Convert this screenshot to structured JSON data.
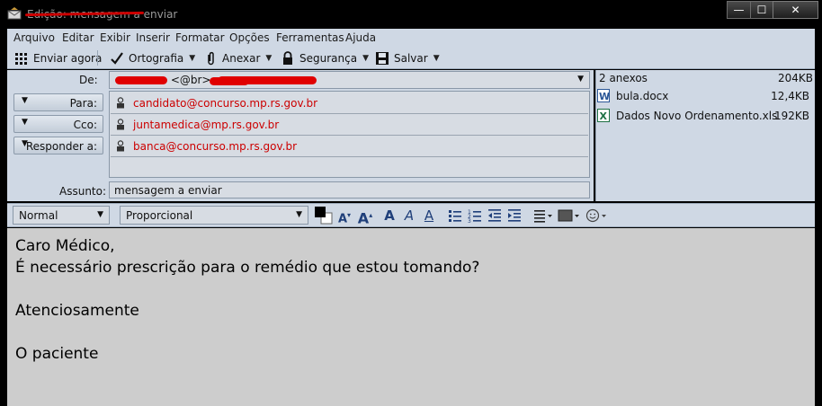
{
  "window": {
    "title": "Edição: mensagem a enviar",
    "buttons": {
      "minimize": "—",
      "maximize": "☐",
      "close": "✕"
    }
  },
  "menu": [
    "Arquivo",
    "Editar",
    "Exibir",
    "Inserir",
    "Formatar",
    "Opções",
    "Ferramentas",
    "Ajuda"
  ],
  "toolbar": {
    "send_label": "Enviar agora",
    "spell_label": "Ortografia",
    "attach_label": "Anexar",
    "security_label": "Segurança",
    "save_label": "Salvar"
  },
  "header": {
    "from_label": "De:",
    "from_value_visible": "<@br>",
    "to_button": "Para:",
    "cc_button": "Cco:",
    "reply_button": "Responder a:",
    "recipients": [
      {
        "address": "candidato@concurso.mp.rs.gov.br"
      },
      {
        "address": "juntamedica@mp.rs.gov.br"
      },
      {
        "address": "banca@concurso.mp.rs.gov.br"
      }
    ],
    "subject_label": "Assunto:",
    "subject_value": "mensagem a enviar"
  },
  "attachments": {
    "summary": "2 anexos",
    "total_size": "204KB",
    "files": [
      {
        "name": "bula.docx",
        "size": "12,4KB",
        "icon": "word-doc-icon"
      },
      {
        "name": "Dados Novo Ordenamento.xls",
        "size": "192KB",
        "icon": "excel-sheet-icon"
      }
    ]
  },
  "format": {
    "paragraph_style": "Normal",
    "font": "Proporcional"
  },
  "body": {
    "lines": [
      "Caro Médico,",
      "É necessário prescrição para o remédio que estou tomando?",
      "",
      "Atenciosamente",
      "",
      "O paciente"
    ]
  },
  "colors": {
    "chrome": "#cfd8e4",
    "field_bg": "#d7dce3",
    "editor_bg": "#cdcdcd",
    "address_red": "#cc0000"
  }
}
